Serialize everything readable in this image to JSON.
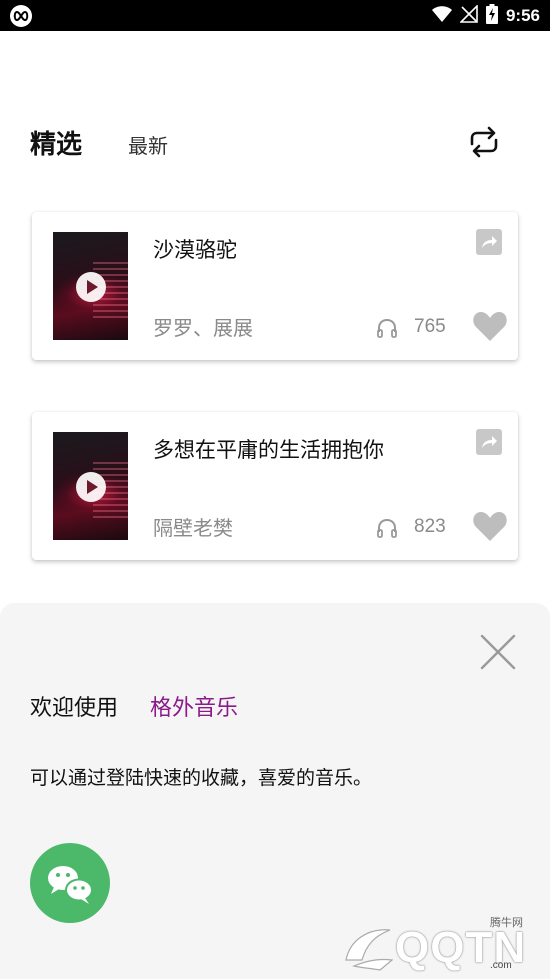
{
  "status_bar": {
    "time": "9:56",
    "app_icon": "infinity-icon",
    "icons": [
      "wifi-icon",
      "signal-icon",
      "battery-charging-icon"
    ],
    "background_color": "#000000"
  },
  "tabs": {
    "active": "精选",
    "inactive": "最新",
    "refresh_icon": "repeat-icon"
  },
  "songs": [
    {
      "title": "沙漠骆驼",
      "artist": "罗罗、展展",
      "plays": "765"
    },
    {
      "title": "多想在平庸的生活拥抱你",
      "artist": "隔壁老樊",
      "plays": "823"
    }
  ],
  "login_sheet": {
    "welcome_prefix": "欢迎使用",
    "brand_name": "格外音乐",
    "description": "可以通过登陆快速的收藏，喜爱的音乐。",
    "close_icon": "close-icon",
    "wechat_icon": "wechat-icon",
    "brand_color": "#8a1a8a",
    "wechat_color": "#4cb86a"
  },
  "watermark": {
    "text": "QQTN",
    "small_text": "腾牛网",
    "url": ".com"
  }
}
